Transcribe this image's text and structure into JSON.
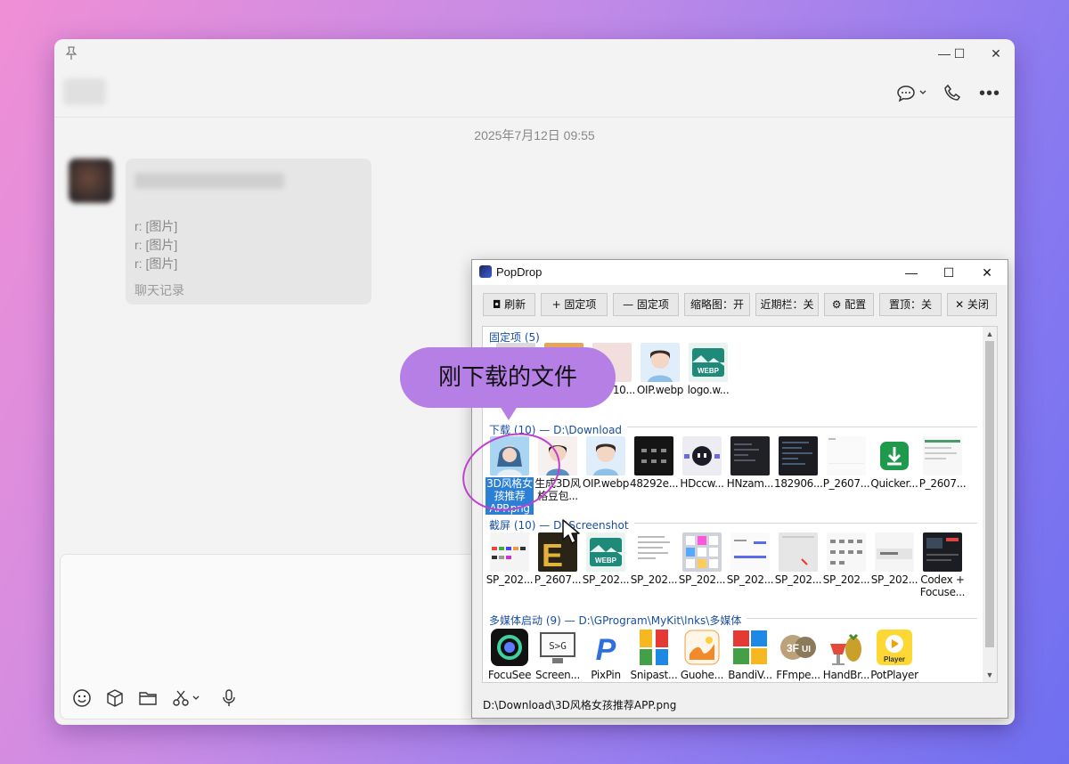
{
  "chat": {
    "timestamp": "2025年7月12日 09:55",
    "bubble_lines": [
      "r: [图片]",
      "r: [图片]",
      "r: [图片]"
    ],
    "bubble_footer": "聊天记录"
  },
  "popdrop": {
    "title": "PopDrop",
    "toolbar": [
      {
        "label": "刷新",
        "icon": "refresh-icon"
      },
      {
        "label": "+ 固定项",
        "icon": "plus-icon"
      },
      {
        "label": "— 固定项",
        "icon": "minus-icon"
      },
      {
        "label": "缩略图：开"
      },
      {
        "label": "近期栏：关"
      },
      {
        "label": "⚙ 配置",
        "icon": "gear-icon"
      },
      {
        "label": "置顶：关"
      },
      {
        "label": "✕ 关闭",
        "icon": "close-icon"
      }
    ],
    "groups": [
      {
        "header": "固定项 (5)",
        "items": [
          "",
          "",
          "图画 10...",
          "OIP.webp",
          "logo.w..."
        ]
      },
      {
        "header": "下载 (10)  —  D:\\Download",
        "items": [
          "3D风格女孩推荐APP.png",
          "生成3D风格豆包...",
          "OIP.webp",
          "48292e...",
          "HDccw...",
          "HNzam...",
          "182906...",
          "P_2607...",
          "Quicker...",
          "P_2607..."
        ]
      },
      {
        "header": "截屏 (10)  —  D:\\Screenshot",
        "items": [
          "SP_202...",
          "P_2607...",
          "SP_202...",
          "SP_202...",
          "SP_202...",
          "SP_202...",
          "SP_202...",
          "SP_202...",
          "SP_202...",
          "Codex + Focuse..."
        ]
      },
      {
        "header": "多媒体启动 (9)  —  D:\\GProgram\\MyKit\\lnks\\多媒体",
        "items": [
          "FocuSee",
          "Screen...",
          "PixPin",
          "Snipast...",
          "Guohe...",
          "BandiV...",
          "FFmpe...",
          "HandBr...",
          "PotPlayer"
        ]
      }
    ],
    "statusbar": "D:\\Download\\3D风格女孩推荐APP.png"
  },
  "annotation": {
    "tooltip": "刚下载的文件"
  },
  "colors": {
    "accent": "#2b7fd4",
    "tooltip": "#b57fe6",
    "group_header": "#1a4fa0"
  }
}
